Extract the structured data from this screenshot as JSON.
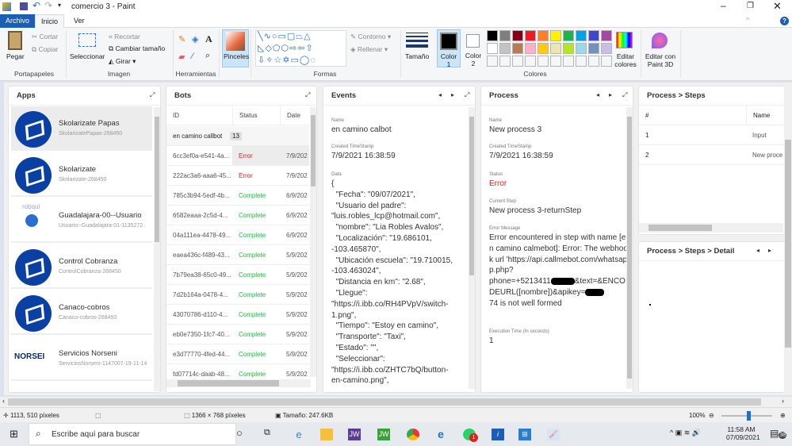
{
  "window": {
    "title": "comercio 3 - Paint"
  },
  "ribbon_tabs": [
    "Archivo",
    "Inicio",
    "Ver"
  ],
  "ribbon": {
    "paste": "Pegar",
    "cut": "Cortar",
    "copy": "Copiar",
    "clipboard_group": "Portapapeles",
    "select": "Seleccionar",
    "crop": "Recortar",
    "resize": "Cambiar tamaño",
    "rotate": "Girar",
    "image_group": "Imagen",
    "tools_group": "Herramientas",
    "brushes": "Pinceles",
    "outline": "Contorno",
    "fill": "Rellenar",
    "shapes_group": "Formas",
    "size": "Tamaño",
    "color1": "Color 1",
    "color2": "Color 2",
    "edit_colors": "Editar colores",
    "colors_group": "Colores",
    "paint3d": "Editar con Paint 3D",
    "palette_row1": [
      "#000000",
      "#7f7f7f",
      "#880015",
      "#ed1c24",
      "#ff7f27",
      "#fff200",
      "#22b14c",
      "#00a2e8",
      "#3f48cc",
      "#a349a4"
    ],
    "palette_row2": [
      "#ffffff",
      "#c3c3c3",
      "#b97a57",
      "#ffaec9",
      "#ffc90e",
      "#efe4b0",
      "#b5e61d",
      "#99d9ea",
      "#7092be",
      "#c8bfe7"
    ]
  },
  "apps": {
    "title": "Apps",
    "items": [
      {
        "name": "Skolarizate Papas",
        "sub": "SkolarizatePapas-268450"
      },
      {
        "name": "Skolarizate",
        "sub": "Skolarizate-268450"
      },
      {
        "name": "Guadalajara-00--Usuario",
        "sub": "Usuario--Guadalajara-01-1135272",
        "logo_text": "robqui"
      },
      {
        "name": "Control Cobranza",
        "sub": "ControlCobranza-268450"
      },
      {
        "name": "Canaco-cobros",
        "sub": "Canaco-cobros-268450"
      },
      {
        "name": "Servicios Norseni",
        "sub": "ServiciosNorseni-1147007-19-11-14",
        "logo_text": "NORSEI"
      }
    ]
  },
  "bots": {
    "title": "Bots",
    "columns": [
      "ID",
      "Status",
      "Date"
    ],
    "group": "en camino callbot",
    "group_count": "13",
    "rows": [
      {
        "id": "6cc3ef0a-e541-4a...",
        "status": "Error",
        "date": "7/9/202"
      },
      {
        "id": "222ac3a6-aaa6-45...",
        "status": "Error",
        "date": "7/9/202"
      },
      {
        "id": "785c3b94-5edf-4b...",
        "status": "Complete",
        "date": "6/9/202"
      },
      {
        "id": "6582eaaa-2c5d-4...",
        "status": "Complete",
        "date": "6/9/202"
      },
      {
        "id": "04a111ea-4478-49...",
        "status": "Complete",
        "date": "6/9/202"
      },
      {
        "id": "eaea436c-f489-43...",
        "status": "Complete",
        "date": "5/9/202"
      },
      {
        "id": "7b79ea38-65c0-49...",
        "status": "Complete",
        "date": "5/9/202"
      },
      {
        "id": "7d2b164a-0478-4...",
        "status": "Complete",
        "date": "5/9/202"
      },
      {
        "id": "43070786-d110-4...",
        "status": "Complete",
        "date": "5/9/202"
      },
      {
        "id": "eb0e7350-1fc7-40...",
        "status": "Complete",
        "date": "5/9/202"
      },
      {
        "id": "e3d77770-4fed-44...",
        "status": "Complete",
        "date": "5/9/202"
      },
      {
        "id": "fd07714c-daab-48...",
        "status": "Complete",
        "date": "5/9/202"
      }
    ]
  },
  "events": {
    "title": "Events",
    "name_label": "Name",
    "name": "en camino calbot",
    "ts_label": "Created TimeStamp",
    "ts": "7/9/2021 16:38:59",
    "data_label": "Data",
    "data": "{\n  \"Fecha\": \"09/07/2021\",\n  \"Usuario del padre\":\n\"luis.robles_lcp@hotmail.com\",\n  \"nombre\": \"Lia Robles Avalos\",\n  \"Localización\": \"19.686101,\n-103.465870\",\n  \"Ubicación escuela\": \"19.710015,\n-103.463024\",\n  \"Distancia en km\": \"2.68\",\n  \"Llegue\":\n\"https://i.ibb.co/RH4PVpV/switch-\n1.png\",\n  \"Tiempo\": \"Estoy en camino\",\n  \"Transporte\": \"Taxi\",\n  \"Estado\": \"\",\n  \"Seleccionar\":\n\"https://i.ibb.co/ZHTC7bQ/button-\nen-camino.png\","
  },
  "process": {
    "title": "Process",
    "name_label": "Name",
    "name": "New process 3",
    "ts_label": "Created TimeStamp",
    "ts": "7/9/2021 16:38:59",
    "status_label": "Status",
    "status": "Error",
    "step_label": "Current Step",
    "step": "New process 3-returnStep",
    "err_label": "Error Message",
    "err_a": "Error encountered in step with name [en camino calmebot]: Error: The webhook url 'https://api.callmebot.com/whatsapp.php?\nphone=+5213411",
    "err_b": "&text=&ENCODEURL([nombre])&apikey=",
    "err_c": "74 is not well formed",
    "exec_label": "Execution Time (In seconds)",
    "exec": "1"
  },
  "steps": {
    "title": "Process > Steps",
    "columns": [
      "#",
      "Name"
    ],
    "rows": [
      {
        "n": "1",
        "name": "Input"
      },
      {
        "n": "2",
        "name": "New proce"
      }
    ]
  },
  "detail": {
    "title": "Process > Steps > Detail"
  },
  "status": {
    "cursor": "1113, 510 píxeles",
    "dimensions": "1366 × 768 píxeles",
    "size": "Tamaño: 247.6KB",
    "zoom": "100%",
    "zoom_percent": 100
  },
  "taskbar": {
    "search": "Escribe aquí para buscar",
    "time": "11:58 AM",
    "date": "07/09/2021",
    "notifications": "38",
    "whatsapp_badge": "1"
  }
}
